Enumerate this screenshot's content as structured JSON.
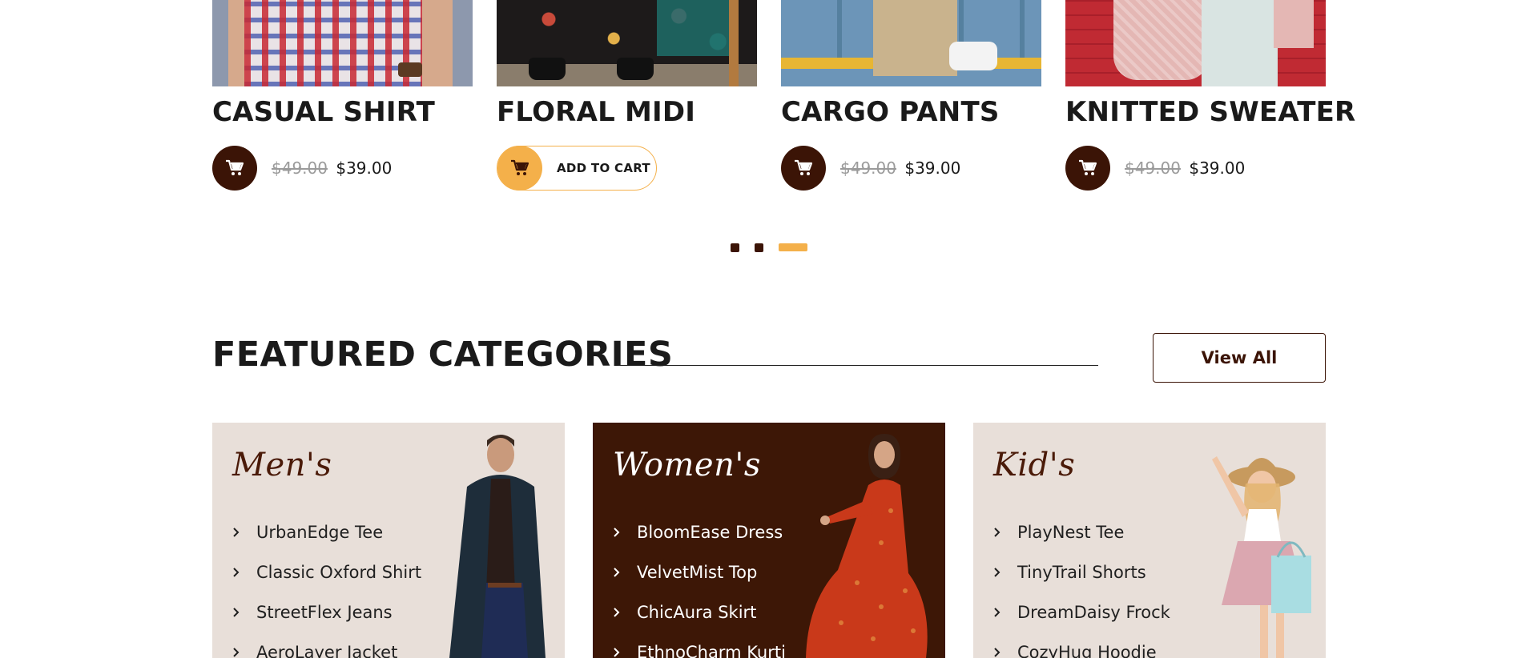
{
  "products": [
    {
      "title": "CASUAL SHIRT",
      "old_price": "$49.00",
      "price": "$39.00",
      "image": "casual-shirt-photo"
    },
    {
      "title": "FLORAL MIDI",
      "add_to_cart_label": "ADD TO CART",
      "image": "floral-midi-photo"
    },
    {
      "title": "CARGO PANTS",
      "old_price": "$49.00",
      "price": "$39.00",
      "image": "cargo-pants-photo"
    },
    {
      "title": "KNITTED SWEATER",
      "old_price": "$49.00",
      "price": "$39.00",
      "image": "knitted-sweater-photo"
    }
  ],
  "carousel": {
    "pages": 3,
    "active_page": 3
  },
  "featured": {
    "title": "FEATURED CATEGORIES",
    "view_all_label": "View All"
  },
  "categories": [
    {
      "title": "Men's",
      "items": [
        "UrbanEdge Tee",
        "Classic Oxford Shirt",
        "StreetFlex Jeans",
        "AeroLayer Jacket"
      ],
      "image": "man-in-coat-photo"
    },
    {
      "title": "Women's",
      "items": [
        "BloomEase Dress",
        "VelvetMist Top",
        "ChicAura Skirt",
        "EthnoCharm Kurti"
      ],
      "image": "woman-in-red-dress-photo"
    },
    {
      "title": "Kid's",
      "items": [
        "PlayNest Tee",
        "TinyTrail Shorts",
        "DreamDaisy Frock",
        "CozyHug Hoodie"
      ],
      "image": "girl-with-shopping-bag-photo"
    }
  ],
  "colors": {
    "brand_dark": "#3b1406",
    "accent": "#f4b04a",
    "card_light": "#e8dfd9",
    "card_dark": "#3d1706"
  },
  "icons": {
    "cart": "cart-icon",
    "chevron": "chevron-right-icon"
  }
}
